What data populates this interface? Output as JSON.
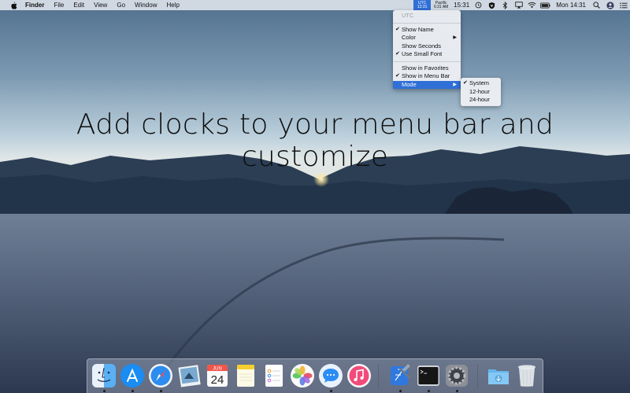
{
  "menubar": {
    "app_name": "Finder",
    "menus": [
      "File",
      "Edit",
      "View",
      "Go",
      "Window",
      "Help"
    ],
    "clocks": [
      {
        "label": "UTC",
        "time": "13:31"
      },
      {
        "label": "Pacific",
        "time": "6:31 AM"
      }
    ],
    "main_clock": "15:31",
    "system_clock": "Mon 14:31"
  },
  "clock_menu": {
    "header": "UTC",
    "group1": [
      {
        "label": "Show Name",
        "checked": true
      },
      {
        "label": "Color",
        "submenu": true
      },
      {
        "label": "Show Seconds"
      },
      {
        "label": "Use Small Font",
        "checked": true
      }
    ],
    "group2": [
      {
        "label": "Show in Favorites"
      },
      {
        "label": "Show in Menu Bar",
        "checked": true
      },
      {
        "label": "Mode",
        "submenu": true,
        "highlighted": true
      }
    ],
    "mode_submenu": [
      {
        "label": "System",
        "checked": true
      },
      {
        "label": "12-hour"
      },
      {
        "label": "24-hour"
      }
    ]
  },
  "headline": "Add clocks to your menu bar and customize",
  "dock": {
    "calendar_month": "JUN",
    "calendar_day": "24"
  },
  "colors": {
    "accent": "#2f6fd6",
    "menubar_bg": "#e1e6ee",
    "headline_text": "#0c0c0c"
  }
}
